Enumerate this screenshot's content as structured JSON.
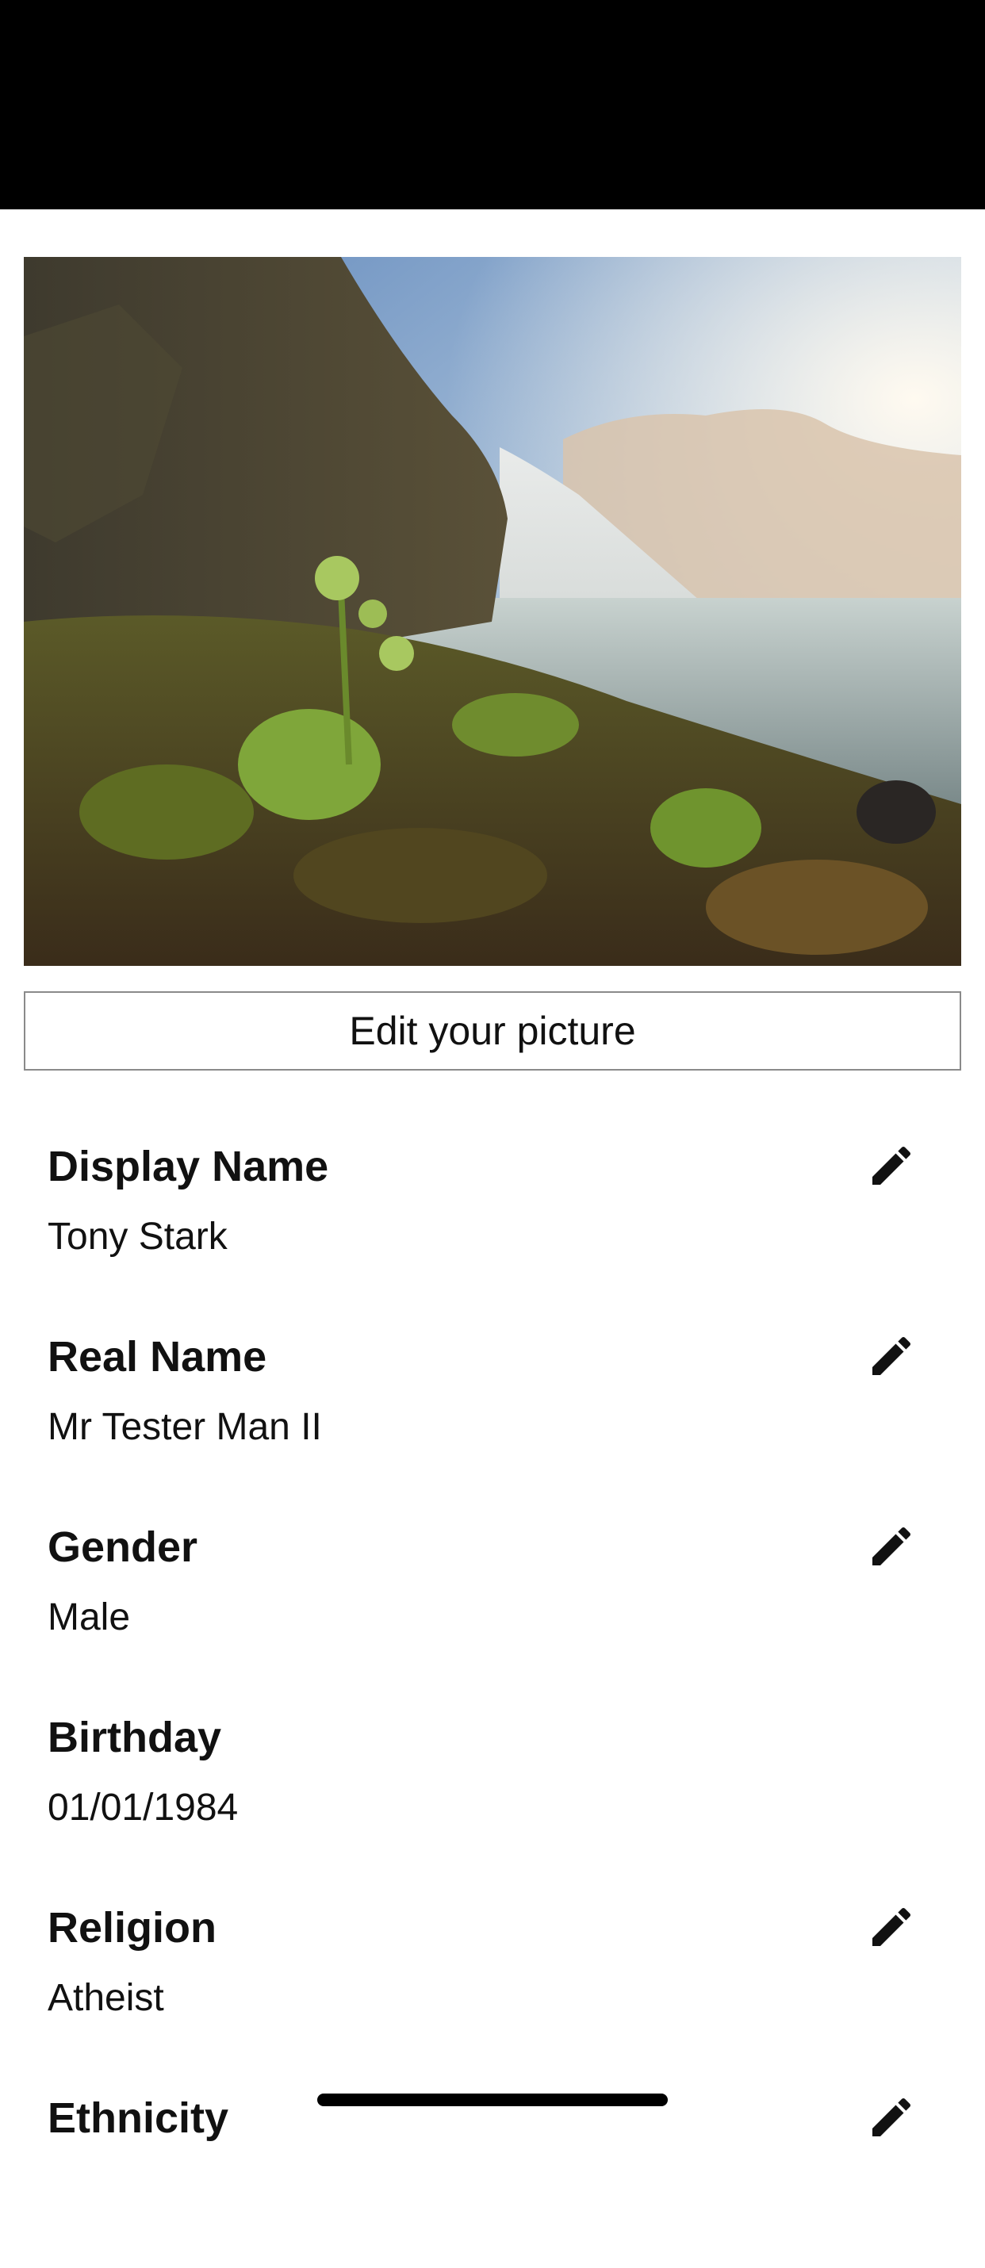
{
  "profile": {
    "edit_picture_label": "Edit your picture",
    "fields": [
      {
        "label": "Display Name",
        "value": "Tony Stark",
        "editable": true
      },
      {
        "label": "Real Name",
        "value": "Mr Tester Man II",
        "editable": true
      },
      {
        "label": "Gender",
        "value": "Male",
        "editable": true
      },
      {
        "label": "Birthday",
        "value": "01/01/1984",
        "editable": false
      },
      {
        "label": "Religion",
        "value": "Atheist",
        "editable": true
      },
      {
        "label": "Ethnicity",
        "value": "",
        "editable": true
      }
    ]
  },
  "icons": {
    "edit": "pencil-icon"
  },
  "colors": {
    "status_bar": "#000000",
    "text": "#111111",
    "button_border": "#8a8a8a",
    "background": "#ffffff"
  }
}
